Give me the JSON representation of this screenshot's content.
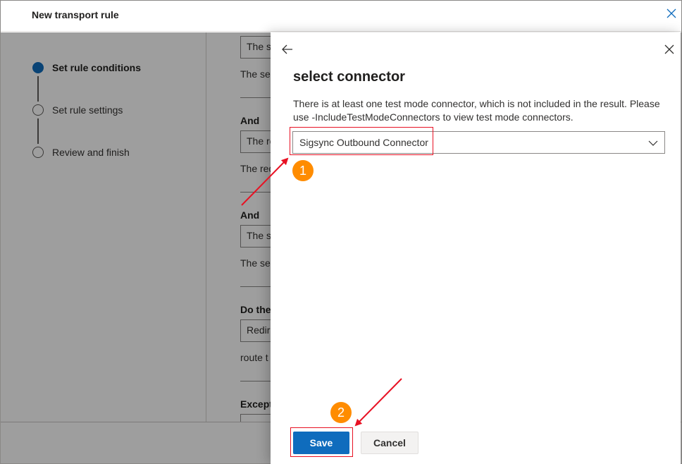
{
  "window": {
    "title": "New transport rule"
  },
  "wizard": {
    "steps": [
      {
        "label": "Set rule conditions",
        "active": true
      },
      {
        "label": "Set rule settings",
        "active": false
      },
      {
        "label": "Review and finish",
        "active": false
      }
    ],
    "conditions": {
      "box1": "The se",
      "text1": "The ser",
      "and1": "And",
      "box2": "The re",
      "text2": "The req",
      "and2": "And",
      "box3": "The se",
      "text3": "The ser",
      "do_head": "Do the",
      "box4": "Redire",
      "text4": "route t",
      "except_head": "Except"
    }
  },
  "panel": {
    "title": "select connector",
    "description": "There is at least one test mode connector, which is not included in the result. Please use -IncludeTestModeConnectors to view test mode connectors.",
    "connector_select": {
      "value": "Sigsync Outbound Connector"
    },
    "save_label": "Save",
    "cancel_label": "Cancel"
  },
  "annotations": {
    "badge1": "1",
    "badge2": "2",
    "color": "#ff8c00",
    "highlight_color": "#e81123"
  }
}
